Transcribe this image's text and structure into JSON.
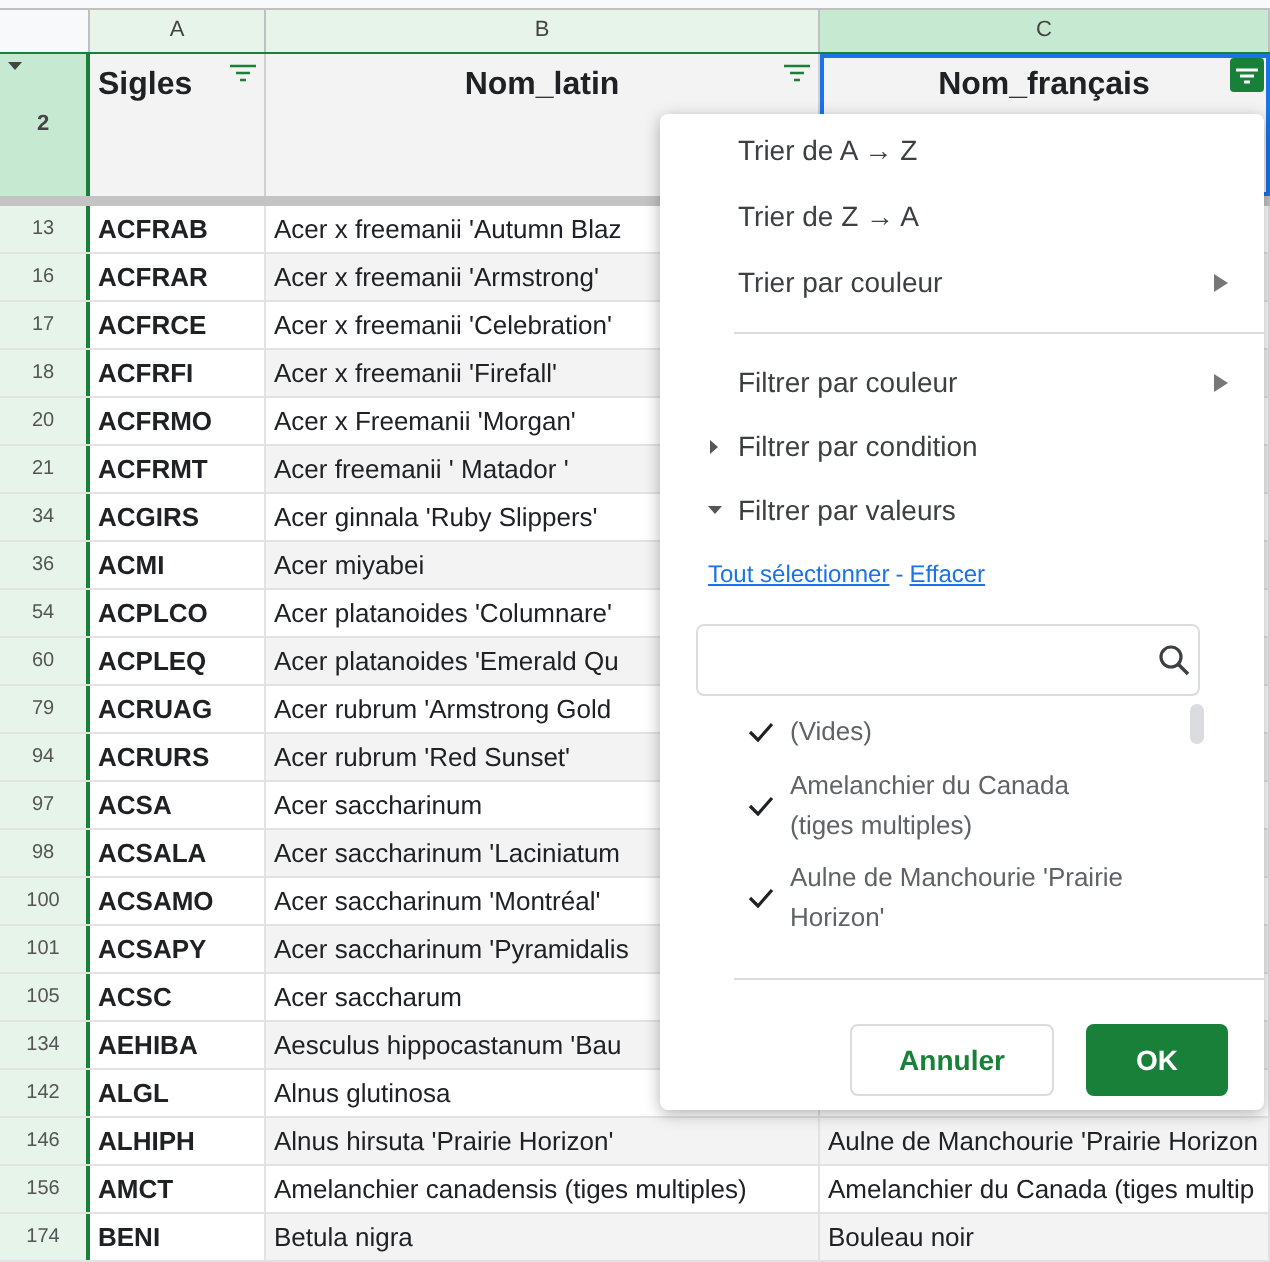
{
  "columns": [
    {
      "letter": "A",
      "selected": false
    },
    {
      "letter": "B",
      "selected": false
    },
    {
      "letter": "C",
      "selected": true
    }
  ],
  "header_row": {
    "row_number": "2",
    "cells": [
      {
        "text": "Sigles",
        "filter_active": false,
        "selected": false
      },
      {
        "text": "Nom_latin",
        "filter_active": false,
        "selected": false
      },
      {
        "text": "Nom_français",
        "filter_active": true,
        "selected": true
      }
    ]
  },
  "rows": [
    {
      "row_number": "13",
      "cells": [
        "ACFRAB",
        "Acer x freemanii 'Autumn Blaz"
      ]
    },
    {
      "row_number": "16",
      "cells": [
        "ACFRAR",
        "Acer x freemanii 'Armstrong'"
      ]
    },
    {
      "row_number": "17",
      "cells": [
        "ACFRCE",
        "Acer x freemanii 'Celebration'"
      ]
    },
    {
      "row_number": "18",
      "cells": [
        "ACFRFI",
        "Acer x freemanii 'Firefall'"
      ]
    },
    {
      "row_number": "20",
      "cells": [
        "ACFRMO",
        "Acer x Freemanii 'Morgan'"
      ]
    },
    {
      "row_number": "21",
      "cells": [
        "ACFRMT",
        "Acer freemanii ' Matador '"
      ]
    },
    {
      "row_number": "34",
      "cells": [
        "ACGIRS",
        "Acer ginnala 'Ruby Slippers'"
      ]
    },
    {
      "row_number": "36",
      "cells": [
        "ACMI",
        "Acer miyabei"
      ]
    },
    {
      "row_number": "54",
      "cells": [
        "ACPLCO",
        "Acer platanoides 'Columnare'"
      ]
    },
    {
      "row_number": "60",
      "cells": [
        "ACPLEQ",
        "Acer platanoides 'Emerald Qu"
      ]
    },
    {
      "row_number": "79",
      "cells": [
        "ACRUAG",
        "Acer rubrum 'Armstrong Gold"
      ]
    },
    {
      "row_number": "94",
      "cells": [
        "ACRURS",
        "Acer rubrum 'Red Sunset'"
      ]
    },
    {
      "row_number": "97",
      "cells": [
        "ACSA",
        "Acer saccharinum"
      ]
    },
    {
      "row_number": "98",
      "cells": [
        "ACSALA",
        "Acer saccharinum 'Laciniatum"
      ]
    },
    {
      "row_number": "100",
      "cells": [
        "ACSAMO",
        "Acer saccharinum 'Montréal'"
      ]
    },
    {
      "row_number": "101",
      "cells": [
        "ACSAPY",
        "Acer saccharinum 'Pyramidalis"
      ]
    },
    {
      "row_number": "105",
      "cells": [
        "ACSC",
        "Acer saccharum"
      ]
    },
    {
      "row_number": "134",
      "cells": [
        "AEHIBA",
        "Aesculus hippocastanum 'Bau"
      ]
    },
    {
      "row_number": "142",
      "cells": [
        "ALGL",
        "Alnus glutinosa"
      ]
    },
    {
      "row_number": "146",
      "cells": [
        "ALHIPH",
        "Alnus hirsuta 'Prairie Horizon'",
        "Aulne de Manchourie 'Prairie Horizon"
      ]
    },
    {
      "row_number": "156",
      "cells": [
        "AMCT",
        "Amelanchier canadensis (tiges multiples)",
        "Amelanchier du Canada (tiges multip"
      ]
    },
    {
      "row_number": "174",
      "cells": [
        "BENI",
        "Betula nigra",
        "Bouleau noir"
      ]
    }
  ],
  "filter_menu": {
    "sort_items": [
      {
        "label": "Trier de A → Z",
        "kind": "plain"
      },
      {
        "label": "Trier de Z → A",
        "kind": "plain"
      },
      {
        "label": "Trier par couleur",
        "kind": "submenu"
      }
    ],
    "filter_items": [
      {
        "label": "Filtrer par couleur",
        "kind": "submenu"
      },
      {
        "label": "Filtrer par condition",
        "kind": "collapsed"
      },
      {
        "label": "Filtrer par valeurs",
        "kind": "expanded"
      }
    ],
    "select_all_link": "Tout sélectionner",
    "link_separator": "-",
    "clear_link": "Effacer",
    "values": [
      {
        "label": "(Vides)",
        "checked": true
      },
      {
        "label": "Amelanchier du Canada (tiges multiples)",
        "checked": true
      },
      {
        "label": "Aulne de Manchourie 'Prairie Horizon'",
        "checked": true
      }
    ],
    "cancel_button": "Annuler",
    "ok_button": "OK"
  }
}
